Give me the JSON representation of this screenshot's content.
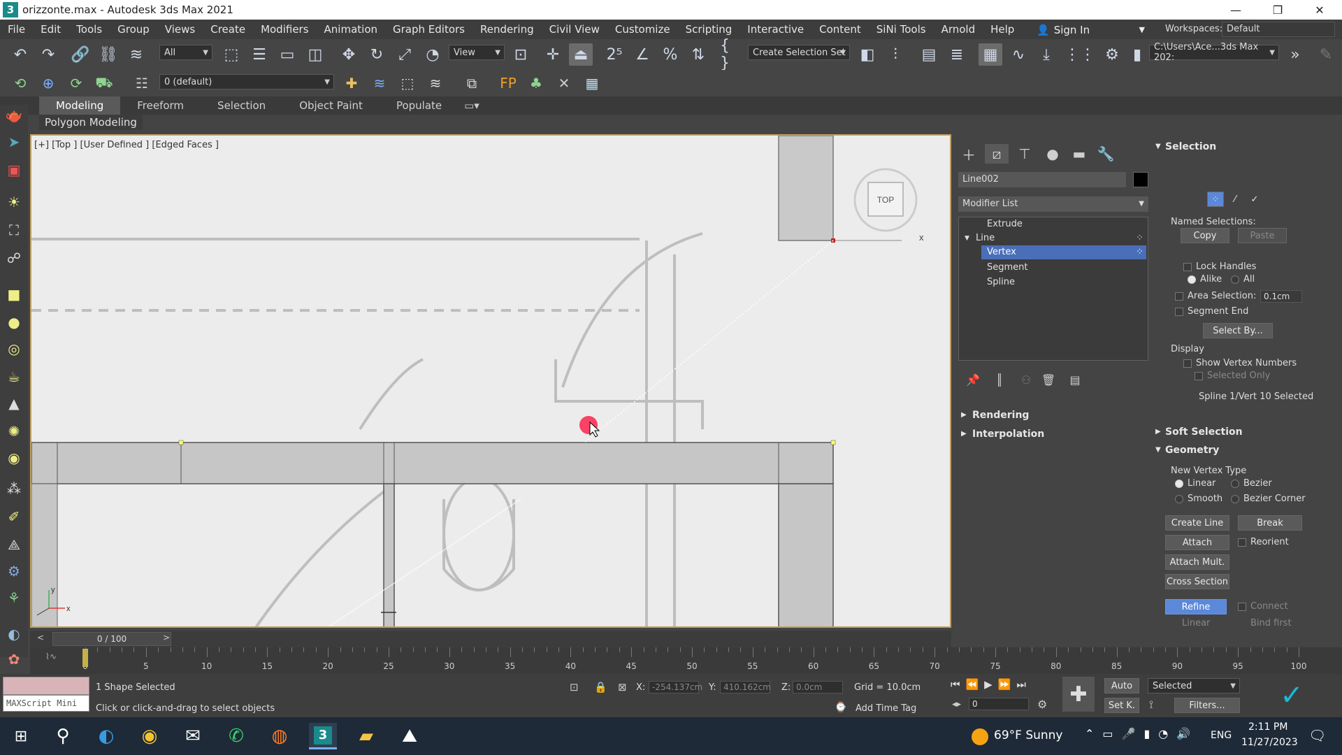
{
  "window": {
    "title": "orizzonte.max - Autodesk 3ds Max 2021",
    "app_icon": "3",
    "minimize": "—",
    "maximize": "❐",
    "close": "✕"
  },
  "menu": [
    "File",
    "Edit",
    "Tools",
    "Group",
    "Views",
    "Create",
    "Modifiers",
    "Animation",
    "Graph Editors",
    "Rendering",
    "Civil View",
    "Customize",
    "Scripting",
    "Interactive",
    "Content",
    "SiNi Tools",
    "Arnold",
    "Help"
  ],
  "account": {
    "sign_in": "Sign In",
    "workspaces_label": "Workspaces:",
    "workspace": "Default"
  },
  "toolbar": {
    "selection_filter": "All",
    "ref_coord": "View",
    "named_set": "Create Selection Set",
    "project_path": "C:\\Users\\Ace...3ds Max 202:",
    "layer": "0 (default)"
  },
  "ribbon": {
    "tabs": [
      "Modeling",
      "Freeform",
      "Selection",
      "Object Paint",
      "Populate"
    ],
    "active": "Modeling",
    "subpanel": "Polygon Modeling"
  },
  "viewport": {
    "label": "[+] [Top ] [User Defined ] [Edged Faces ]",
    "viewcube": "TOP",
    "axis_x": "x",
    "axis_y": "y"
  },
  "command_panel": {
    "object_name": "Line002",
    "modifier_list": "Modifier List",
    "stack": [
      "Extrude",
      "Line",
      "Vertex",
      "Segment",
      "Spline"
    ],
    "rollouts": [
      "Rendering",
      "Interpolation"
    ]
  },
  "selection": {
    "header": "Selection",
    "named_selections": "Named Selections:",
    "copy": "Copy",
    "paste": "Paste",
    "lock_handles": "Lock Handles",
    "alike": "Alike",
    "all": "All",
    "area_selection": "Area Selection:",
    "area_value": "0.1cm",
    "segment_end": "Segment End",
    "select_by": "Select By...",
    "display": "Display",
    "show_vertex_numbers": "Show Vertex Numbers",
    "selected_only": "Selected Only",
    "status": "Spline 1/Vert 10 Selected"
  },
  "soft_selection": {
    "header": "Soft Selection"
  },
  "geometry": {
    "header": "Geometry",
    "new_vertex_type": "New Vertex Type",
    "linear": "Linear",
    "bezier": "Bezier",
    "smooth": "Smooth",
    "bezier_corner": "Bezier Corner",
    "create_line": "Create Line",
    "break": "Break",
    "attach": "Attach",
    "reorient": "Reorient",
    "attach_mult": "Attach Mult.",
    "cross_section": "Cross Section",
    "refine": "Refine",
    "connect": "Connect",
    "linear2": "Linear",
    "bind_first": "Bind first"
  },
  "timeline": {
    "frame": "0 / 100",
    "labels": [
      "0",
      "5",
      "10",
      "15",
      "20",
      "25",
      "30",
      "35",
      "40",
      "45",
      "50",
      "55",
      "60",
      "65",
      "70",
      "75",
      "80",
      "85",
      "90",
      "95",
      "100"
    ]
  },
  "status": {
    "maxscript": "MAXScript Mini",
    "selected": "1 Shape Selected",
    "prompt": "Click or click-and-drag to select objects",
    "x_label": "X:",
    "x": "-254.137cm",
    "y_label": "Y:",
    "y": "410.162cm",
    "z_label": "Z:",
    "z": "0.0cm",
    "grid": "Grid = 10.0cm",
    "add_time_tag": "Add Time Tag",
    "auto": "Auto",
    "selected_mode": "Selected",
    "set_key": "Set K.",
    "filters": "Filters...",
    "frame_field": "0"
  },
  "taskbar": {
    "weather": "69°F  Sunny",
    "lang": "ENG",
    "time": "2:11 PM",
    "date": "11/27/2023"
  },
  "colors": {
    "viewport_border": "#bfa062",
    "selection_blue": "#4a6fb8",
    "refine_blue": "#5b88d9"
  }
}
